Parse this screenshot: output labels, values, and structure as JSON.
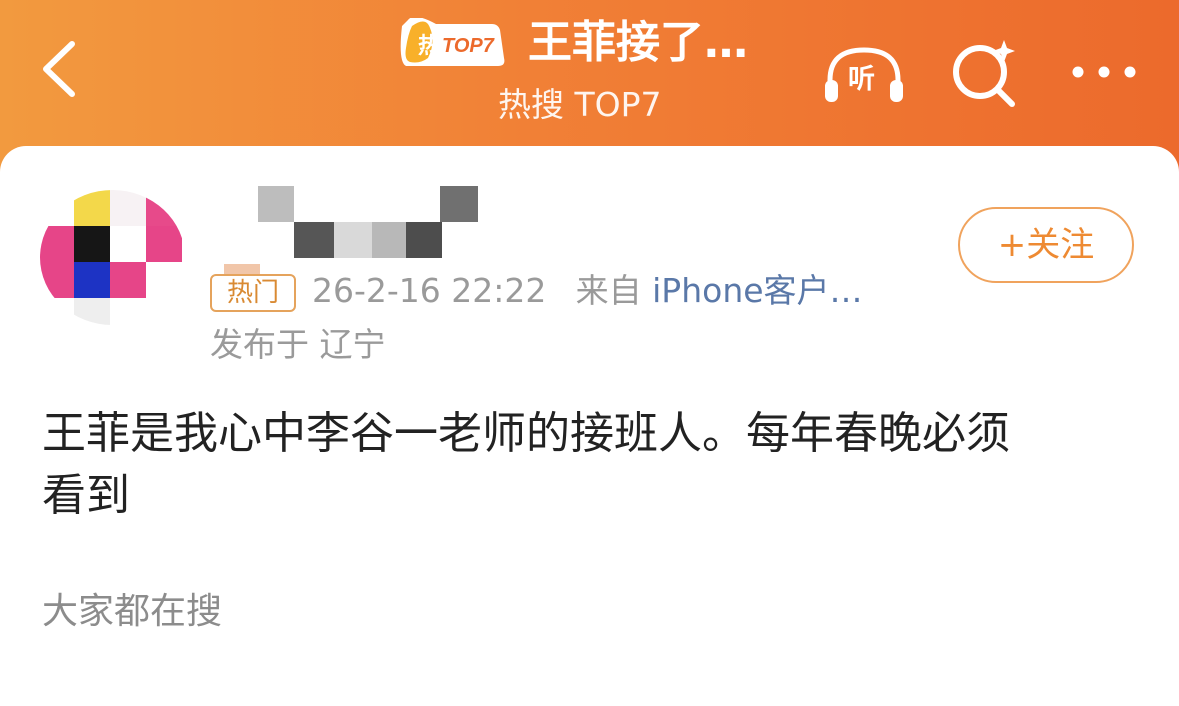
{
  "header": {
    "badge_hot": "热",
    "badge_rank": "TOP7",
    "title": "王菲接了…",
    "subtitle": "热搜 TOP7",
    "listen_label": "听",
    "colors": {
      "gradient_start": "#f29a3f",
      "gradient_end": "#ec6a2c"
    },
    "icons": [
      "back-arrow-icon",
      "listen-headphones-icon",
      "search-sparkle-icon",
      "more-dots-icon"
    ]
  },
  "post": {
    "hot_tag": "热门",
    "date": "26-2-16 22:22",
    "source_prefix": "来自",
    "source": "iPhone客户…",
    "location": "发布于 辽宁",
    "follow_button": "+关注",
    "content_line1": "王菲是我心中李谷一老师的接班人。每年春晚必须",
    "content_line2": "看到"
  },
  "section": {
    "title": "大家都在搜"
  }
}
